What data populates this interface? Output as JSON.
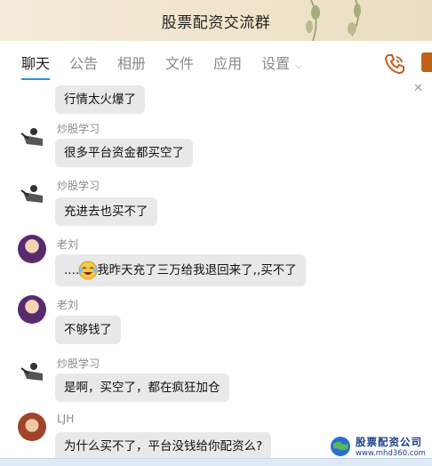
{
  "window": {
    "title": "股票配资交流群"
  },
  "tabs": [
    {
      "label": "聊天"
    },
    {
      "label": "公告"
    },
    {
      "label": "相册"
    },
    {
      "label": "文件"
    },
    {
      "label": "应用"
    },
    {
      "label": "设置"
    }
  ],
  "icons": {
    "phone": "phone-icon",
    "close": "close-icon",
    "caret": "chevron-down-icon",
    "close_glyph": "✕",
    "caret_glyph": "⌵"
  },
  "messages": [
    {
      "sender": "",
      "text": "行情太火爆了"
    },
    {
      "sender": "炒股学习",
      "text": "很多平台资金都买空了"
    },
    {
      "sender": "炒股学习",
      "text": "充进去也买不了"
    },
    {
      "sender": "老刘",
      "text_before": "....",
      "text_after": "我昨天充了三万给我退回来了,,买不了",
      "emoji": "laughing-crying-emoji"
    },
    {
      "sender": "老刘",
      "text": "不够钱了"
    },
    {
      "sender": "炒股学习",
      "text": "是啊，买空了，都在疯狂加仓"
    },
    {
      "sender": "LJH",
      "text": "为什么买不了，平台没钱给你配资么?"
    }
  ],
  "watermark": {
    "title": "股票配资公司",
    "url": "www.mhd360.com"
  },
  "colors": {
    "accent": "#2a8fe6",
    "bubble": "#e9e9e9",
    "title_bar": "#f4ecd9",
    "phone": "#c0601a"
  }
}
